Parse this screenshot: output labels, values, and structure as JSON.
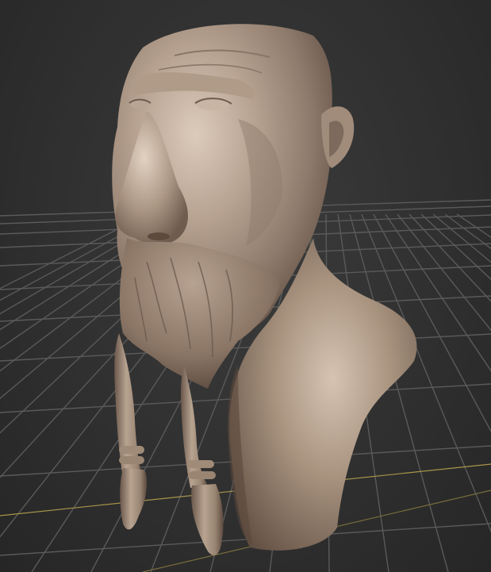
{
  "scene": {
    "background_color": "#2e2e2e",
    "grid_color": "#5a5a5a",
    "axis_color": "#b8a24a",
    "model_color": "#a4907f",
    "model_highlight": "#d9c8b8",
    "model_shadow": "#5b4a3f",
    "model_description_icon": "sculpted-bust"
  }
}
